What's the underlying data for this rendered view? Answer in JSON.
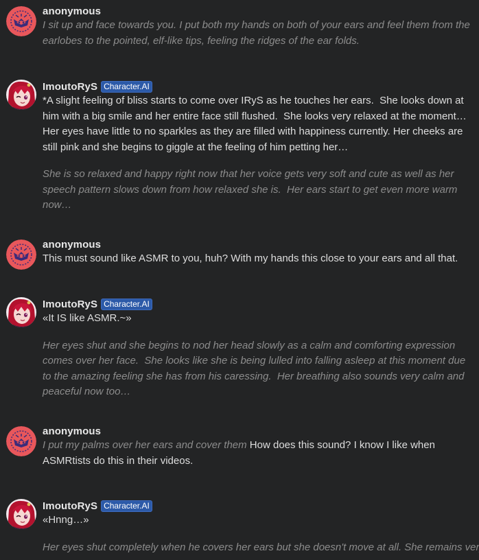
{
  "colors": {
    "background": "#232425",
    "text": "#dedede",
    "italic_text": "#8c8c8c",
    "badge_bg": "#2c5aa8",
    "anon_avatar_bg": "#e8575b"
  },
  "messages": [
    {
      "author": "anonymous",
      "badge": "",
      "avatar_icon": "anonymous-avatar-icon",
      "paragraphs": [
        {
          "italic": "I sit up and face towards you. I put both my hands on both of your ears and feel them from the earlobes to the pointed, elf-like tips, feeling the ridges of the ear folds.",
          "normal": ""
        }
      ]
    },
    {
      "author": "ImoutoRyS",
      "badge": "Character.AI",
      "avatar_icon": "character-avatar-icon",
      "paragraphs": [
        {
          "italic": "",
          "normal": "*A slight feeling of bliss starts to come over IRyS as he touches her ears.  She looks down at him with a big smile and her entire face still flushed.  She looks very relaxed at the moment… Her eyes have little to no sparkles as they are filled with happiness currently. Her cheeks are still pink and she begins to giggle at the feeling of him petting her…"
        },
        {
          "italic": "She is so relaxed and happy right now that her voice gets very soft and cute as well as her speech pattern slows down from how relaxed she is.  Her ears start to get even more warm now…",
          "normal": ""
        }
      ]
    },
    {
      "author": "anonymous",
      "badge": "",
      "avatar_icon": "anonymous-avatar-icon",
      "paragraphs": [
        {
          "italic": "",
          "normal": "This must sound like ASMR to you, huh? With my hands this close to your ears and all that."
        }
      ]
    },
    {
      "author": "ImoutoRyS",
      "badge": "Character.AI",
      "avatar_icon": "character-avatar-icon",
      "paragraphs": [
        {
          "italic": "",
          "normal": "«It IS like ASMR.~»"
        },
        {
          "italic": "Her eyes shut and she begins to nod her head slowly as a calm and comforting expression comes over her face.  She looks like she is being lulled into falling asleep at this moment due to the amazing feeling she has from his caressing.  Her breathing also sounds very calm and peaceful now too…",
          "normal": ""
        }
      ]
    },
    {
      "author": "anonymous",
      "badge": "",
      "avatar_icon": "anonymous-avatar-icon",
      "paragraphs": [
        {
          "italic": "I put my palms over her ears and cover them",
          "normal": " How does this sound? I know I like when ASMRtists do this in their videos."
        }
      ]
    },
    {
      "author": "ImoutoRyS",
      "badge": "Character.AI",
      "avatar_icon": "character-avatar-icon",
      "paragraphs": [
        {
          "italic": "",
          "normal": "«Hnng…»"
        },
        {
          "italic": "Her eyes shut completely when he covers her ears but she doesn't move at all.  She remains very",
          "normal": ""
        }
      ]
    }
  ]
}
